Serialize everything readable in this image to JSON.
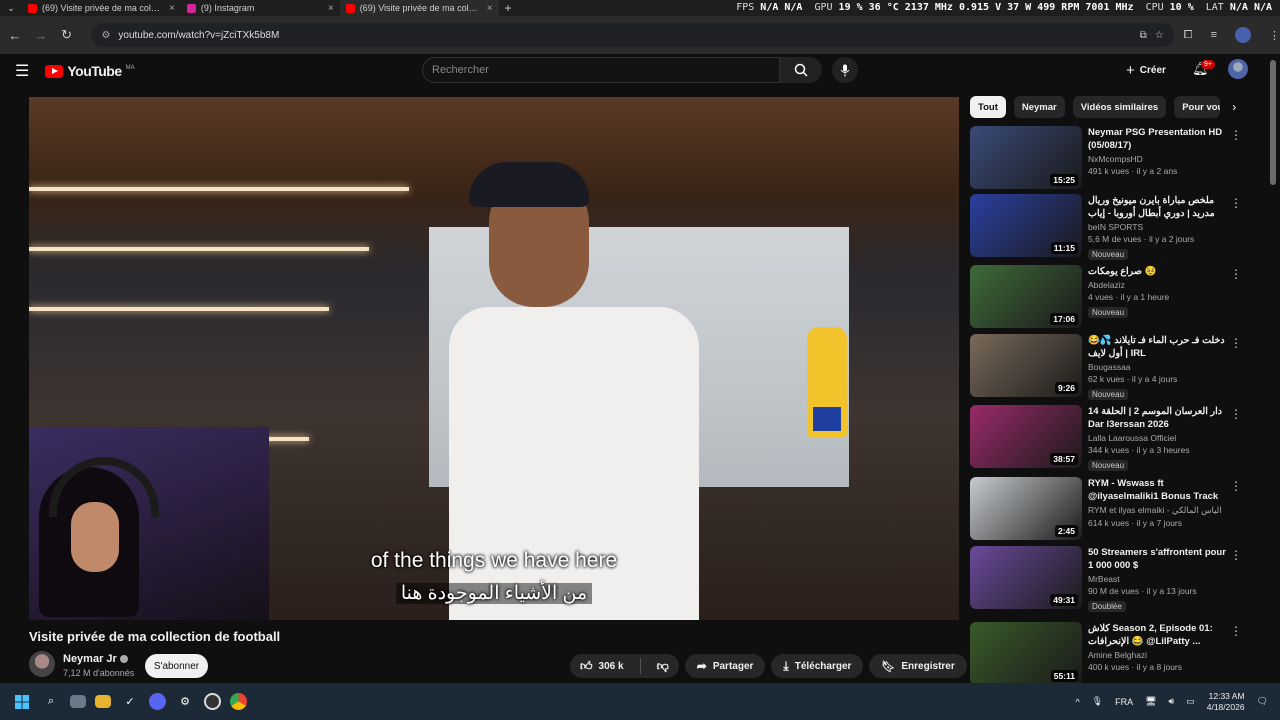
{
  "browser": {
    "tabs": [
      {
        "title": "(69) Visite privée de ma collection de football",
        "favicon_color": "#ff0000",
        "active": false
      },
      {
        "title": "(9) Instagram",
        "favicon_color": "#d6249f",
        "active": false
      },
      {
        "title": "(69) Visite privée de ma collection de football",
        "favicon_color": "#ff0000",
        "active": true
      }
    ],
    "new_tab": "+",
    "url": "youtube.com/watch?v=jZciTXk5b8M"
  },
  "hud": {
    "fps_label": "FPS",
    "fps_value": "N/A",
    "fps_value2": "N/A",
    "gpu_label": "GPU",
    "gpu_values": "19 %  36 °C  2137 MHz  0.915 V  37 W  499 RPM  7001 MHz",
    "cpu_label": "CPU",
    "cpu_value": "10 %",
    "lat_label": "LAT",
    "lat_value": "N/A",
    "lat_value2": "N/A"
  },
  "youtube": {
    "logo_text": "YouTube",
    "country": "MA",
    "search_placeholder": "Rechercher",
    "create_label": "Créer",
    "notif_count": "9+"
  },
  "video": {
    "subtitle_en": "of the things we have here",
    "subtitle_ar": "من الأشياء الموجودة هنا",
    "title": "Visite privée de ma collection de football",
    "channel": "Neymar Jr",
    "subscribers": "7,12 M d'abonnés",
    "subscribe_label": "S'abonner",
    "likes": "306 k",
    "share_label": "Partager",
    "download_label": "Télécharger",
    "save_label": "Enregistrer"
  },
  "chips": [
    "Tout",
    "Neymar",
    "Vidéos similaires",
    "Pour vous"
  ],
  "recommendations": [
    {
      "title": "Neymar PSG Presentation HD (05/08/17)",
      "channel": "NxMcompsHD",
      "meta": "491 k vues · il y a 2 ans",
      "duration": "15:25",
      "new": "",
      "thumb": "#3a4a78"
    },
    {
      "title": "ملخص مباراة بايرن ميونيخ وريال مدريد | دوري أبطال أوروبا - إياب ربع النهائي",
      "channel": "beIN SPORTS",
      "meta": "5,6 M de vues · il y a 2 jours",
      "duration": "11:15",
      "new": "Nouveau",
      "thumb": "#2b3fa0"
    },
    {
      "title": "صراع يومكات 🥹",
      "channel": "Abdelaziz",
      "meta": "4 vues · il y a 1 heure",
      "duration": "17:06",
      "new": "Nouveau",
      "thumb": "#3f6a3a"
    },
    {
      "title": "دخلت فـ حرب الماء فـ تايلاند 💦😂 | أول لايف IRL",
      "channel": "Bougassaa",
      "meta": "62 k vues · il y a 4 jours",
      "duration": "9:26",
      "new": "Nouveau",
      "thumb": "#7a6a5a"
    },
    {
      "title": "دار العرسان الموسم 2 | الحلقة 14 Dar l3erssan 2026",
      "channel": "Lalla Laaroussa Officiel",
      "meta": "344 k vues · il y a 3 heures",
      "duration": "38:57",
      "new": "Nouveau",
      "thumb": "#9a2a6a"
    },
    {
      "title": "RYM - Wswass ft @ilyaselmaliki1 Bonus Track ...",
      "channel": "RYM et ilyas elmaiki - الياس المالكي",
      "meta": "614 k vues · il y a 7 jours",
      "duration": "2:45",
      "new": "",
      "thumb": "#c8ccd0"
    },
    {
      "title": "50 Streamers s'affrontent pour 1 000 000 $",
      "channel": "MrBeast",
      "meta": "90 M de vues · il y a 13 jours",
      "duration": "49:31",
      "new": "Doublée",
      "thumb": "#6a4a9a"
    },
    {
      "title": "كلاش Season 2, Episode 01: الإنحرافات 😂 @LilPatty ...",
      "channel": "Amine Belghazi",
      "meta": "400 k vues · il y a 8 jours",
      "duration": "55:11",
      "new": "",
      "thumb": "#3a5a2a"
    }
  ],
  "tray": {
    "lang": "FRA",
    "time": "12:33 AM",
    "date": "4/18/2026"
  }
}
